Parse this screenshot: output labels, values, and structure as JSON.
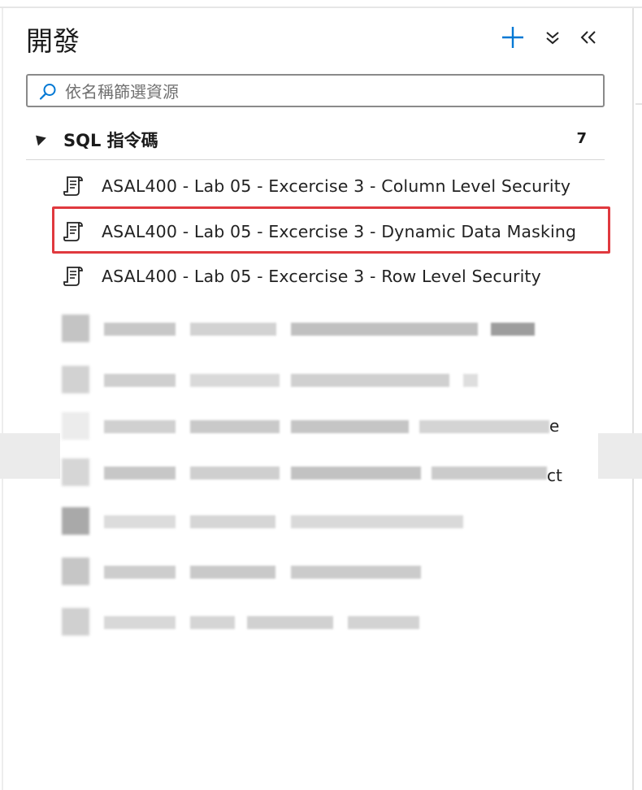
{
  "panel": {
    "title": "開發",
    "add_icon": "plus-icon",
    "expand_all_icon": "chevron-double-down-icon",
    "collapse_panel_icon": "chevron-double-left-icon",
    "accent_color": "#0078d4"
  },
  "search": {
    "placeholder": "依名稱篩選資源",
    "value": "",
    "icon": "search-icon"
  },
  "group": {
    "label": "SQL 指令碼",
    "count": "7",
    "caret_icon": "caret-expanded-icon"
  },
  "scripts": [
    {
      "label": "ASAL400 - Lab 05 - Excercise 3 - Column Level Security",
      "icon": "sql-script-icon"
    },
    {
      "label": "ASAL400 - Lab 05 - Excercise 3 - Dynamic Data Masking",
      "icon": "sql-script-icon",
      "highlighted": true
    },
    {
      "label": "ASAL400 - Lab 05 - Excercise 3 - Row Level Security",
      "icon": "sql-script-icon"
    }
  ],
  "obscured_items": {
    "trailing_fragments": [
      "e",
      "ct"
    ]
  },
  "colors": {
    "highlight_border": "#e0393e",
    "divider": "#e1e1e1"
  }
}
